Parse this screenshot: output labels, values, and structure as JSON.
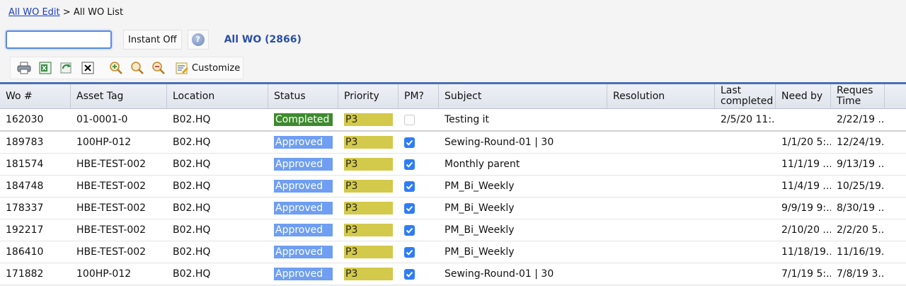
{
  "breadcrumb": {
    "link": "All WO Edit",
    "separator": ">",
    "current": "All WO List"
  },
  "search": {
    "value": "",
    "placeholder": ""
  },
  "instant_label": "Instant Off",
  "help_label": "?",
  "wo_count_label": "All WO (2866)",
  "toolbar": {
    "customize_label": "Customize"
  },
  "colors": {
    "completed": "#3e8a2e",
    "approved": "#6f9ef2",
    "priority": "#d3c94a",
    "link": "#1a3cc7",
    "accent": "#4a6fb3"
  },
  "columns": [
    "Wo #",
    "Asset Tag",
    "Location",
    "Status",
    "Priority",
    "PM?",
    "Subject",
    "Resolution",
    "Last completed",
    "Need by",
    "Reques Time"
  ],
  "rows": [
    {
      "wo": "162030",
      "asset": "01-0001-0",
      "location": "B02.HQ",
      "status": "Completed",
      "priority": "P3",
      "pm": false,
      "subject": "Testing it",
      "resolution": "",
      "last_completed": "2/5/20 11:...",
      "need_by": "",
      "request_time": "2/22/19 ..."
    },
    {
      "wo": "189783",
      "asset": "100HP-012",
      "location": "B02.HQ",
      "status": "Approved",
      "priority": "P3",
      "pm": true,
      "subject": "Sewing-Round-01 | 30",
      "resolution": "",
      "last_completed": "",
      "need_by": "1/1/20 5:...",
      "request_time": "12/24/19..."
    },
    {
      "wo": "181574",
      "asset": "HBE-TEST-002",
      "location": "B02.HQ",
      "status": "Approved",
      "priority": "P3",
      "pm": true,
      "subject": "Monthly parent",
      "resolution": "",
      "last_completed": "",
      "need_by": "11/1/19 ...",
      "request_time": "9/13/19 ..."
    },
    {
      "wo": "184748",
      "asset": "HBE-TEST-002",
      "location": "B02.HQ",
      "status": "Approved",
      "priority": "P3",
      "pm": true,
      "subject": "PM_Bi_Weekly",
      "resolution": "",
      "last_completed": "",
      "need_by": "11/4/19 ...",
      "request_time": "10/25/19..."
    },
    {
      "wo": "178337",
      "asset": "HBE-TEST-002",
      "location": "B02.HQ",
      "status": "Approved",
      "priority": "P3",
      "pm": true,
      "subject": "PM_Bi_Weekly",
      "resolution": "",
      "last_completed": "",
      "need_by": "9/9/19 9:...",
      "request_time": "8/30/19 ..."
    },
    {
      "wo": "192217",
      "asset": "HBE-TEST-002",
      "location": "B02.HQ",
      "status": "Approved",
      "priority": "P3",
      "pm": true,
      "subject": "PM_Bi_Weekly",
      "resolution": "",
      "last_completed": "",
      "need_by": "2/10/20 ...",
      "request_time": "2/2/20 5..."
    },
    {
      "wo": "186410",
      "asset": "HBE-TEST-002",
      "location": "B02.HQ",
      "status": "Approved",
      "priority": "P3",
      "pm": true,
      "subject": "PM_Bi_Weekly",
      "resolution": "",
      "last_completed": "",
      "need_by": "11/18/19...",
      "request_time": "11/16/19..."
    },
    {
      "wo": "171882",
      "asset": "100HP-012",
      "location": "B02.HQ",
      "status": "Approved",
      "priority": "P3",
      "pm": true,
      "subject": "Sewing-Round-01 | 30",
      "resolution": "",
      "last_completed": "",
      "need_by": "7/1/19 5:...",
      "request_time": "7/8/19 3..."
    }
  ]
}
